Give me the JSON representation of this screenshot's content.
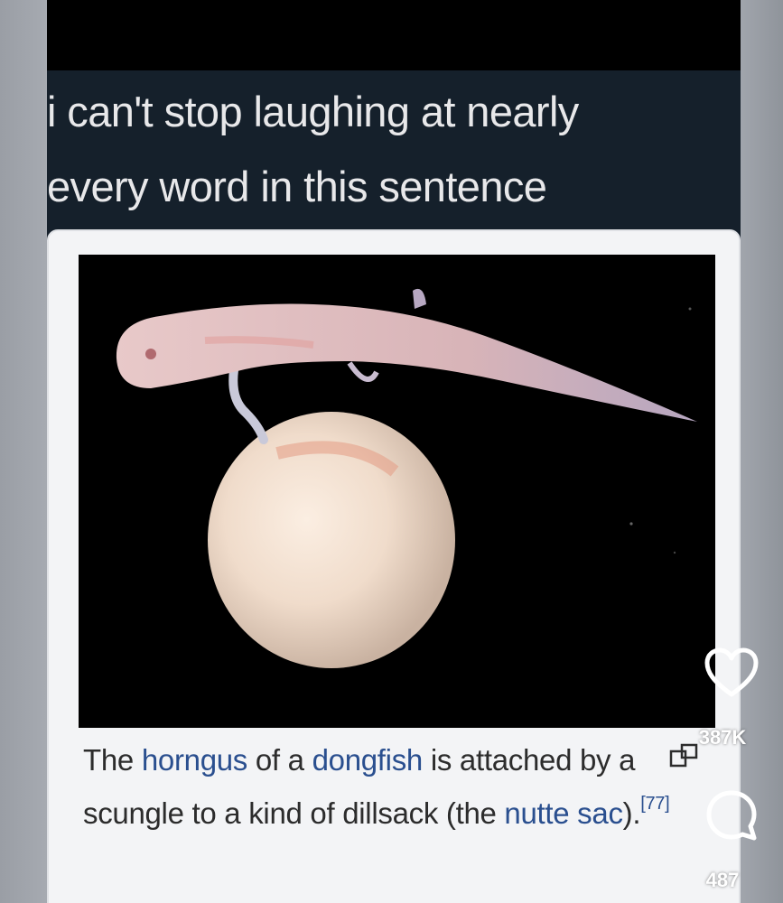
{
  "post": {
    "text": "i can't stop laughing at nearly\nevery word in this sentence"
  },
  "card": {
    "image_alt": "fish embryo attached to yolk sac",
    "caption": {
      "part1": "The ",
      "link1": "horngus",
      "part2": " of a ",
      "link2": "dongfish",
      "part3": " is attached by a scungle to a kind of dillsack (the ",
      "link3": "nutte sac",
      "part4": ").",
      "citation": "[77]"
    }
  },
  "actions": {
    "likes": "387K",
    "comments": "487"
  },
  "icons": {
    "like": "heart-icon",
    "comment": "comment-icon",
    "tag": "tag-icon"
  },
  "colors": {
    "post_background": "#15202b",
    "card_background": "#f3f4f6",
    "link": "#2a4f8f",
    "page_background": "#8e939a"
  }
}
